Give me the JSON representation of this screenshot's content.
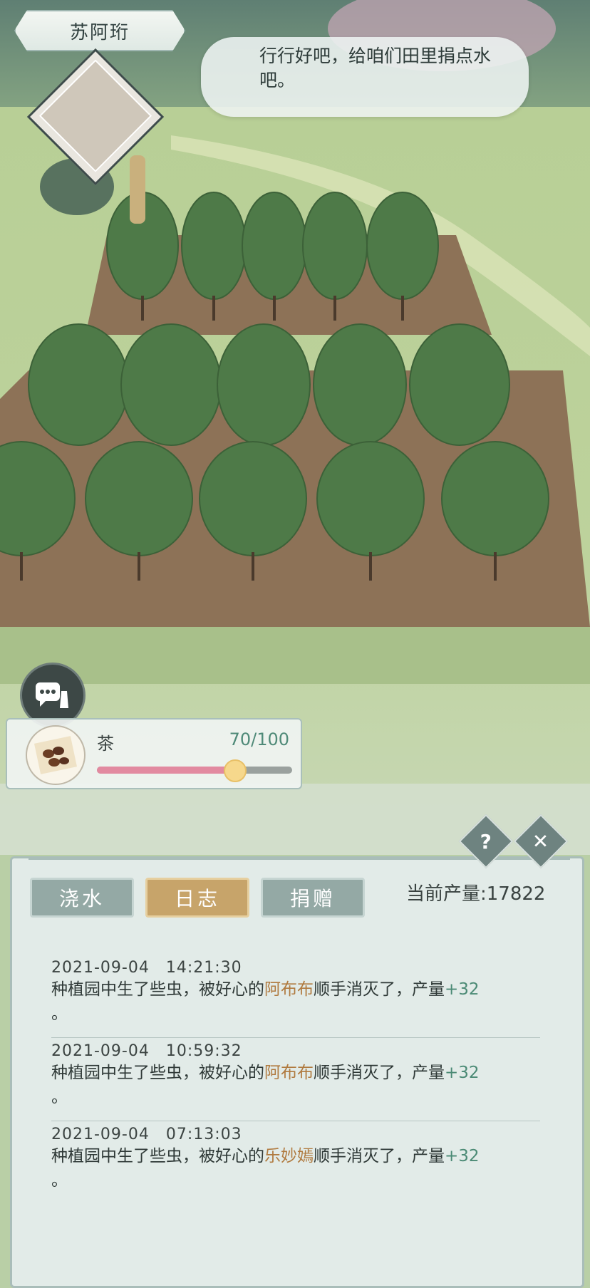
{
  "npc": {
    "name": "苏阿珩",
    "speech": "行行好吧，给咱们田里捐点水吧。"
  },
  "resource": {
    "name": "茶",
    "count": "70/100",
    "progress": 0.7
  },
  "panel": {
    "tabs": [
      {
        "label": "浇水",
        "active": false
      },
      {
        "label": "日志",
        "active": true
      },
      {
        "label": "捐赠",
        "active": false
      }
    ],
    "production_label": "当前产量:17822",
    "help_label": "?",
    "logs": [
      {
        "time": "2021-09-04　14:21:30",
        "prefix": "种植园中生了些虫，被好心的",
        "who": "阿布布",
        "middle": "顺手消灭了，产量",
        "delta": "+32",
        "suffix": "。"
      },
      {
        "time": "2021-09-04　10:59:32",
        "prefix": "种植园中生了些虫，被好心的",
        "who": "阿布布",
        "middle": "顺手消灭了，产量",
        "delta": "+32",
        "suffix": "。"
      },
      {
        "time": "2021-09-04　07:13:03",
        "prefix": "种植园中生了些虫，被好心的",
        "who": "乐妙嫣",
        "middle": "顺手消灭了，产量",
        "delta": "+32",
        "suffix": "。"
      }
    ]
  },
  "colors": {
    "accent": "#c7a46a",
    "progress": "#e28aa0",
    "number": "#4b8a75",
    "name": "#b07a3f"
  }
}
